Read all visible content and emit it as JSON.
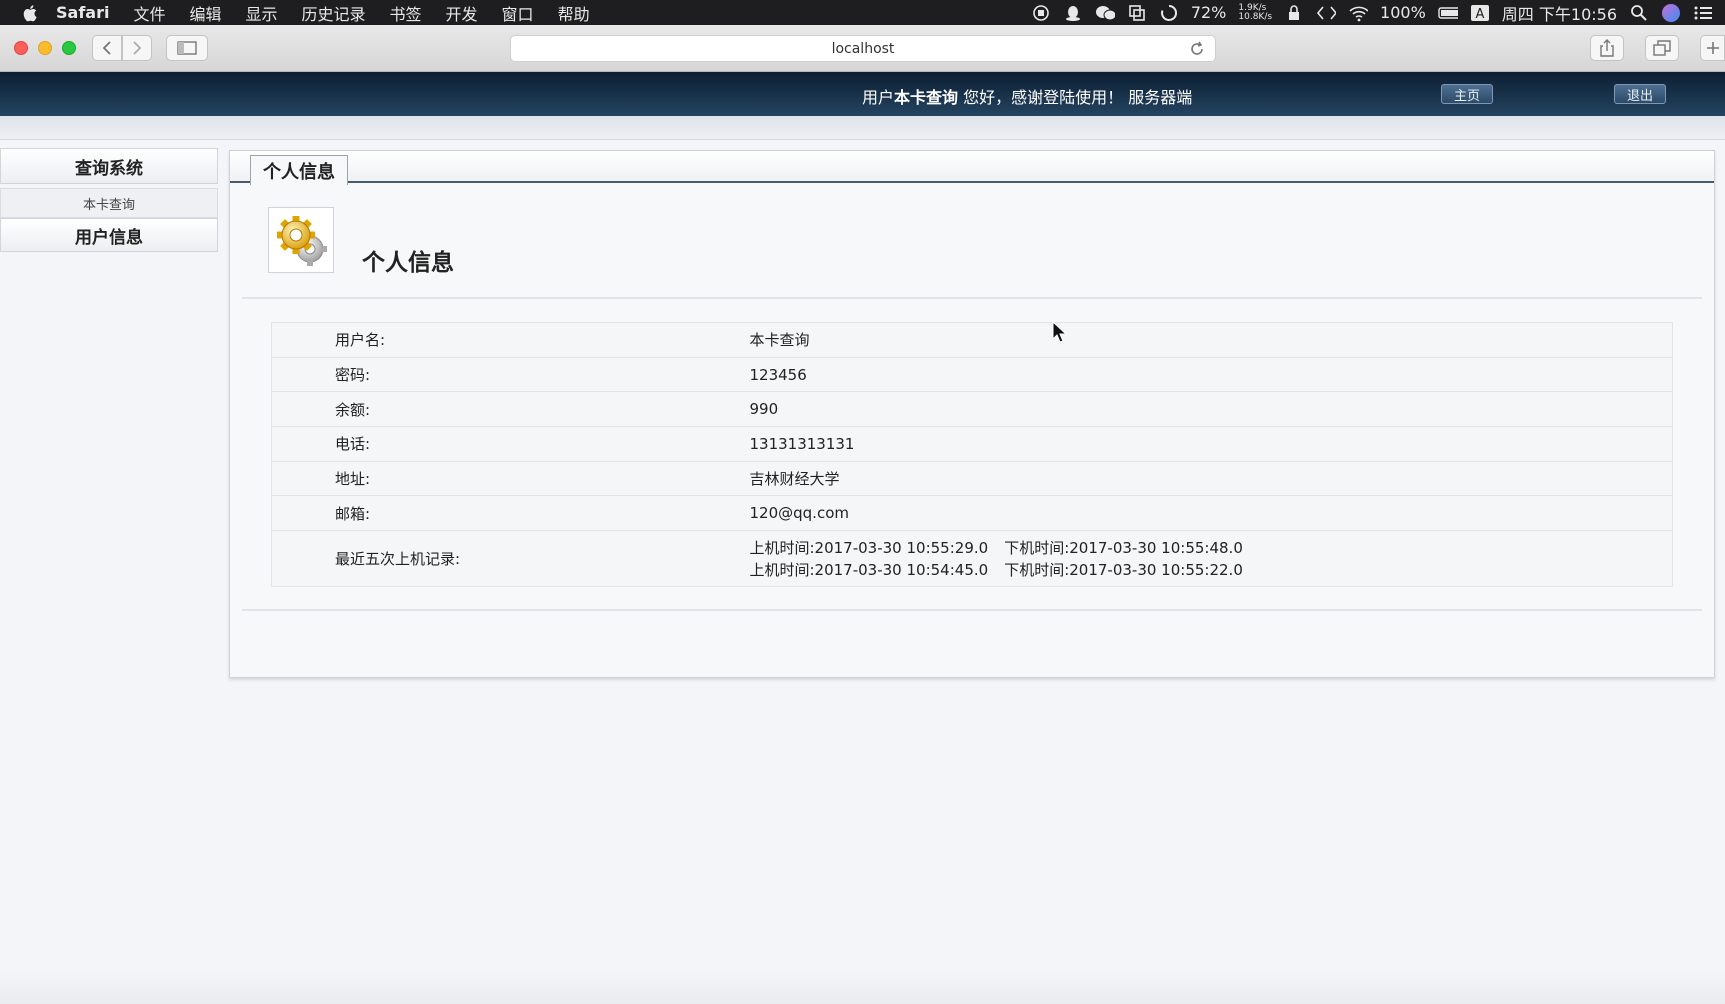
{
  "menubar": {
    "app_name": "Safari",
    "items": [
      "文件",
      "编辑",
      "显示",
      "历史记录",
      "书签",
      "开发",
      "窗口",
      "帮助"
    ],
    "battery_percent_1": "72%",
    "net_up": "1.9K/s",
    "net_down": "10.8K/s",
    "battery_percent_2": "100%",
    "input_method": "A",
    "clock": "周四 下午10:56"
  },
  "browser": {
    "url": "localhost"
  },
  "header": {
    "welcome_prefix": "用户",
    "username": "本卡查询",
    "welcome_suffix": " 您好，感谢登陆使用！",
    "server_label": "服务器端",
    "home_button": "主页",
    "logout_button": "退出"
  },
  "sidebar": {
    "sections": [
      {
        "title": "查询系统",
        "items": [
          "本卡查询"
        ]
      },
      {
        "title": "用户信息",
        "items": []
      }
    ]
  },
  "main": {
    "tab_label": "个人信息",
    "heading": "个人信息",
    "rows": [
      {
        "label": "用户名:",
        "value": "本卡查询"
      },
      {
        "label": "密码:",
        "value": "123456"
      },
      {
        "label": "余额:",
        "value": "990"
      },
      {
        "label": "电话:",
        "value": "13131313131"
      },
      {
        "label": "地址:",
        "value": "吉林财经大学"
      },
      {
        "label": "邮箱:",
        "value": "120@qq.com"
      }
    ],
    "records_label": "最近五次上机记录:",
    "records": [
      {
        "on": "上机时间:2017-03-30 10:55:29.0",
        "off": "下机时间:2017-03-30 10:55:48.0"
      },
      {
        "on": "上机时间:2017-03-30 10:54:45.0",
        "off": "下机时间:2017-03-30 10:55:22.0"
      }
    ]
  },
  "colors": {
    "header_dark": "#0c1f33",
    "header_light": "#24435f",
    "accent_border": "#4a5a6e"
  }
}
